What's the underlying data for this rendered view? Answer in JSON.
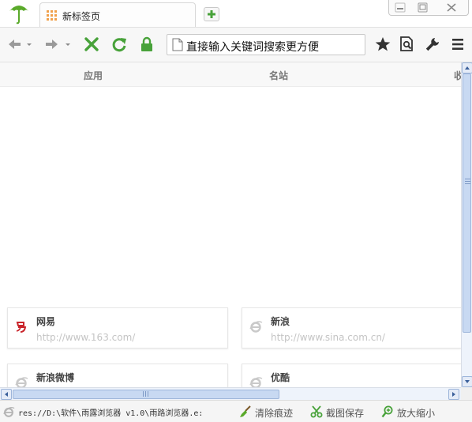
{
  "tab": {
    "title": "新标签页"
  },
  "address_bar": {
    "value": "直接输入关键词搜索更方便"
  },
  "header": {
    "col_apps": "应用",
    "col_sites": "名站",
    "col_more": "收"
  },
  "cards": [
    {
      "name": "网易",
      "url": "http://www.163.com/",
      "icon": "netease-icon"
    },
    {
      "name": "新浪",
      "url": "http://www.sina.com.cn/",
      "icon": "ie-icon"
    },
    {
      "name": "新浪微博",
      "url": "",
      "icon": "ie-icon"
    },
    {
      "name": "优酷",
      "url": "",
      "icon": "ie-icon"
    }
  ],
  "status": {
    "path": "res://D:\\软件\\雨露浏览器 v1.0\\雨路浏览器.e:",
    "clear_label": "清除痕迹",
    "screenshot_label": "截图保存",
    "zoom_label": "放大缩小"
  },
  "colors": {
    "accent_green": "#5aaa2a",
    "stop_red_x": "#48a23a",
    "scroll_blue": "#c8d9f2"
  }
}
